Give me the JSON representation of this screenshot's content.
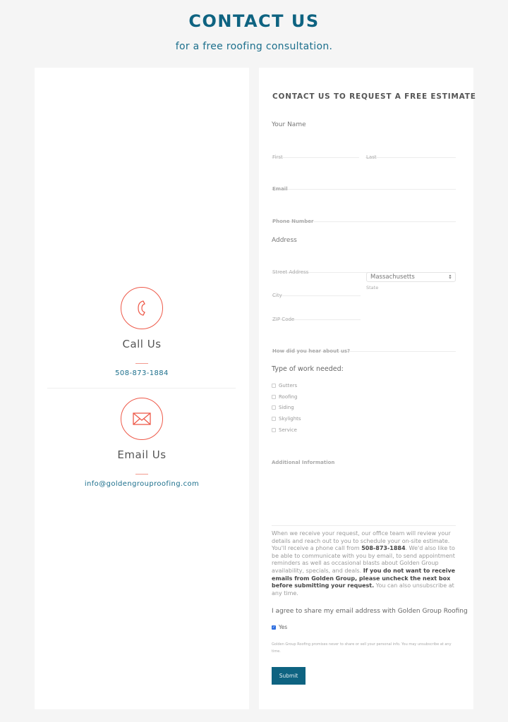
{
  "header": {
    "title": "CONTACT US",
    "subtitle": "for a free roofing consultation."
  },
  "contact": {
    "call": {
      "icon": "phone-icon",
      "heading": "Call Us",
      "phone": "508-873-1884"
    },
    "email": {
      "icon": "envelope-icon",
      "heading": "Email Us",
      "address": "info@goldengrouproofing.com"
    }
  },
  "form": {
    "title": "CONTACT US TO REQUEST A FREE ESTIMATE",
    "name_label": "Your Name",
    "first_placeholder": "First",
    "last_placeholder": "Last",
    "email_placeholder": "Email",
    "phone_placeholder": "Phone Number",
    "address_label": "Address",
    "street_placeholder": "Street Address",
    "city_placeholder": "City",
    "state_value": "Massachusetts",
    "state_label": "State",
    "zip_placeholder": "ZIP Code",
    "heard_placeholder": "How did you hear about us?",
    "work_title": "Type of work needed:",
    "work_options": [
      {
        "label": "Gutters",
        "checked": false
      },
      {
        "label": "Roofing",
        "checked": false
      },
      {
        "label": "Siding",
        "checked": false
      },
      {
        "label": "Skylights",
        "checked": false
      },
      {
        "label": "Service",
        "checked": false
      }
    ],
    "additional_placeholder": "Additional Information",
    "disclaimer": {
      "part1": "When we receive your request, our office team will review your details and reach out to you to schedule your on-site estimate. You'll receive a phone call from ",
      "phone": "508-873-1884",
      "part2": ". We'd also like to be able to communicate with you by email, to send appointment reminders as well as occasional blasts about Golden Group availability, specials, and deals. ",
      "bold": "If you do not want to receive emails from Golden Group, please uncheck the next box before submitting your request.",
      "part3": " You can also unsubscribe at any time."
    },
    "agree_label": "I agree to share my email address with Golden Group Roofing",
    "yes_label": "Yes",
    "yes_checked": true,
    "privacy": "Golden Group Roofing promises never to share or sell your personal info. You may unsubscribe at any time.",
    "submit_label": "Submit"
  },
  "colors": {
    "brand": "#0e6381",
    "accent": "#ee5a4a",
    "link": "#1c6f8c"
  }
}
